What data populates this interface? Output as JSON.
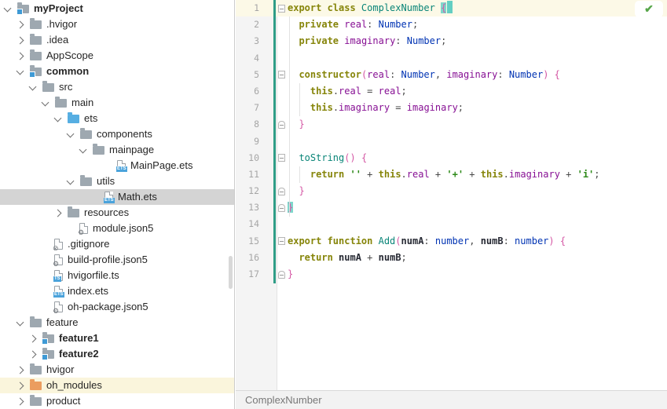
{
  "colors": {
    "keyword": "#86850a",
    "class_name": "#0a8578",
    "field": "#871094",
    "parameter": "#871094",
    "variable": "#272a34",
    "type": "#0033b3",
    "punctuation": "#4a4a4a",
    "string": "#2e8a1a",
    "bracket": "#d457a4",
    "brace_match_bg": "#7fd6cb",
    "caret_block": "#63cec2",
    "caret_line_bg": "#fcf9e7",
    "vcs_added_bar": "#2f9d87",
    "selected_row_bg": "#d4d4d4",
    "library_row_bg": "#faf5dc",
    "folder": "#9ea8b0",
    "folder_source": "#56aee2",
    "folder_library": "#eb9d5f",
    "module_square": "#3f9ad5",
    "file_badge": "#4ba3db",
    "inspection_ok": "#57a64a",
    "panel_divider": "#cccccc"
  },
  "tree": {
    "rows": [
      {
        "label": "myProject",
        "level": 0,
        "chev": "down",
        "icon": "module",
        "bold": true
      },
      {
        "label": ".hvigor",
        "level": 1,
        "chev": "right",
        "icon": "folder"
      },
      {
        "label": ".idea",
        "level": 1,
        "chev": "right",
        "icon": "folder"
      },
      {
        "label": "AppScope",
        "level": 1,
        "chev": "right",
        "icon": "folder"
      },
      {
        "label": "common",
        "level": 1,
        "chev": "down",
        "icon": "module",
        "bold": true
      },
      {
        "label": "src",
        "level": 2,
        "chev": "down",
        "icon": "folder"
      },
      {
        "label": "main",
        "level": 3,
        "chev": "down",
        "icon": "folder"
      },
      {
        "label": "ets",
        "level": 4,
        "chev": "down",
        "icon": "folder-source"
      },
      {
        "label": "components",
        "level": 5,
        "chev": "down",
        "icon": "folder"
      },
      {
        "label": "mainpage",
        "level": 6,
        "chev": "down",
        "icon": "folder"
      },
      {
        "label": "MainPage.ets",
        "level": 7,
        "icon": "ets-file"
      },
      {
        "label": "utils",
        "level": 5,
        "chev": "down",
        "icon": "folder"
      },
      {
        "label": "Math.ets",
        "level": 6,
        "icon": "ets-file",
        "selected": true
      },
      {
        "label": "resources",
        "level": 4,
        "chev": "right",
        "icon": "folder"
      },
      {
        "label": "module.json5",
        "level": 4,
        "icon": "json5-file"
      },
      {
        "label": ".gitignore",
        "level": 2,
        "icon": "gitignore-file"
      },
      {
        "label": "build-profile.json5",
        "level": 2,
        "icon": "json5-file"
      },
      {
        "label": "hvigorfile.ts",
        "level": 2,
        "icon": "ts-file"
      },
      {
        "label": "index.ets",
        "level": 2,
        "icon": "ets-file"
      },
      {
        "label": "oh-package.json5",
        "level": 2,
        "icon": "json5-file"
      },
      {
        "label": "feature",
        "level": 1,
        "chev": "down",
        "icon": "folder"
      },
      {
        "label": "feature1",
        "level": 2,
        "chev": "right",
        "icon": "module",
        "bold": true
      },
      {
        "label": "feature2",
        "level": 2,
        "chev": "right",
        "icon": "module",
        "bold": true
      },
      {
        "label": "hvigor",
        "level": 1,
        "chev": "right",
        "icon": "folder"
      },
      {
        "label": "oh_modules",
        "level": 1,
        "chev": "right",
        "icon": "folder-library",
        "library": true
      },
      {
        "label": "product",
        "level": 1,
        "chev": "right",
        "icon": "folder"
      }
    ]
  },
  "editor": {
    "lines": [
      {
        "n": "1",
        "fold": "open",
        "seg": [
          [
            "k",
            "export class "
          ],
          [
            "c",
            "ComplexNumber"
          ],
          [
            "o",
            " "
          ],
          [
            "B",
            "{"
          ],
          [
            "caret",
            ""
          ]
        ]
      },
      {
        "n": "2",
        "seg": [
          [
            "o",
            "  "
          ],
          [
            "k",
            "private"
          ],
          [
            "o",
            " "
          ],
          [
            "f",
            "real"
          ],
          [
            "o",
            ": "
          ],
          [
            "t",
            "Number"
          ],
          [
            "o",
            ";"
          ]
        ]
      },
      {
        "n": "3",
        "seg": [
          [
            "o",
            "  "
          ],
          [
            "k",
            "private"
          ],
          [
            "o",
            " "
          ],
          [
            "f",
            "imaginary"
          ],
          [
            "o",
            ": "
          ],
          [
            "t",
            "Number"
          ],
          [
            "o",
            ";"
          ]
        ]
      },
      {
        "n": "4",
        "seg": []
      },
      {
        "n": "5",
        "fold": "open",
        "seg": [
          [
            "o",
            "  "
          ],
          [
            "k",
            "constructor"
          ],
          [
            "b",
            "("
          ],
          [
            "p",
            "real"
          ],
          [
            "o",
            ": "
          ],
          [
            "t",
            "Number"
          ],
          [
            "o",
            ", "
          ],
          [
            "p",
            "imaginary"
          ],
          [
            "o",
            ": "
          ],
          [
            "t",
            "Number"
          ],
          [
            "b",
            ")"
          ],
          [
            "o",
            " "
          ],
          [
            "b",
            "{"
          ]
        ]
      },
      {
        "n": "6",
        "seg": [
          [
            "o",
            "    "
          ],
          [
            "k",
            "this"
          ],
          [
            "o",
            "."
          ],
          [
            "f",
            "real"
          ],
          [
            "o",
            " = "
          ],
          [
            "p",
            "real"
          ],
          [
            "o",
            ";"
          ]
        ]
      },
      {
        "n": "7",
        "seg": [
          [
            "o",
            "    "
          ],
          [
            "k",
            "this"
          ],
          [
            "o",
            "."
          ],
          [
            "f",
            "imaginary"
          ],
          [
            "o",
            " = "
          ],
          [
            "p",
            "imaginary"
          ],
          [
            "o",
            ";"
          ]
        ]
      },
      {
        "n": "8",
        "fold": "close",
        "seg": [
          [
            "o",
            "  "
          ],
          [
            "b",
            "}"
          ]
        ]
      },
      {
        "n": "9",
        "seg": []
      },
      {
        "n": "10",
        "fold": "open",
        "seg": [
          [
            "o",
            "  "
          ],
          [
            "c",
            "toString"
          ],
          [
            "b",
            "()"
          ],
          [
            "o",
            " "
          ],
          [
            "b",
            "{"
          ]
        ]
      },
      {
        "n": "11",
        "seg": [
          [
            "o",
            "    "
          ],
          [
            "k",
            "return"
          ],
          [
            "o",
            " "
          ],
          [
            "s",
            "''"
          ],
          [
            "o",
            " + "
          ],
          [
            "k",
            "this"
          ],
          [
            "o",
            "."
          ],
          [
            "f",
            "real"
          ],
          [
            "o",
            " + "
          ],
          [
            "s",
            "'+'"
          ],
          [
            "o",
            " + "
          ],
          [
            "k",
            "this"
          ],
          [
            "o",
            "."
          ],
          [
            "f",
            "imaginary"
          ],
          [
            "o",
            " + "
          ],
          [
            "s",
            "'i'"
          ],
          [
            "o",
            ";"
          ]
        ]
      },
      {
        "n": "12",
        "fold": "close",
        "seg": [
          [
            "o",
            "  "
          ],
          [
            "b",
            "}"
          ]
        ]
      },
      {
        "n": "13",
        "fold": "close",
        "seg": [
          [
            "B",
            "}"
          ]
        ]
      },
      {
        "n": "14",
        "seg": []
      },
      {
        "n": "15",
        "fold": "open",
        "seg": [
          [
            "k",
            "export function "
          ],
          [
            "c",
            "Add"
          ],
          [
            "b",
            "("
          ],
          [
            "v",
            "numA"
          ],
          [
            "o",
            ": "
          ],
          [
            "t",
            "number"
          ],
          [
            "o",
            ", "
          ],
          [
            "v",
            "numB"
          ],
          [
            "o",
            ": "
          ],
          [
            "t",
            "number"
          ],
          [
            "b",
            ")"
          ],
          [
            "o",
            " "
          ],
          [
            "b",
            "{"
          ]
        ]
      },
      {
        "n": "16",
        "seg": [
          [
            "o",
            "  "
          ],
          [
            "k",
            "return"
          ],
          [
            "o",
            " "
          ],
          [
            "v",
            "numA"
          ],
          [
            "o",
            " + "
          ],
          [
            "v",
            "numB"
          ],
          [
            "o",
            ";"
          ]
        ]
      },
      {
        "n": "17",
        "fold": "close",
        "seg": [
          [
            "b",
            "}"
          ]
        ]
      }
    ]
  },
  "status": {
    "breadcrumb": "ComplexNumber",
    "inspection_icon": "check"
  }
}
